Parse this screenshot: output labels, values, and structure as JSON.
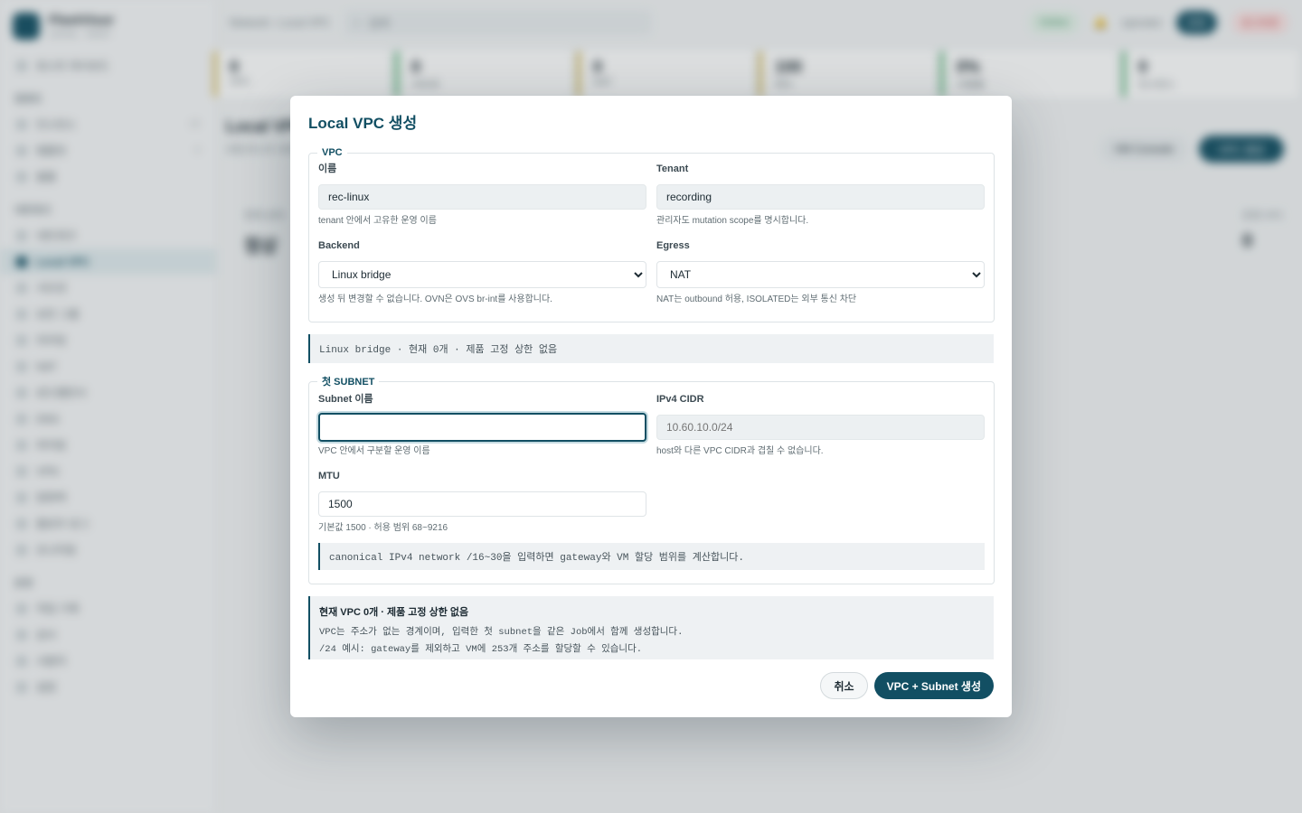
{
  "background": {
    "brand": {
      "name": "FleetVisor",
      "sub": "LOCAL · HOST"
    },
    "sidebar_top": "호스트 대시보드",
    "sections": [
      {
        "title": "컴퓨트",
        "items": [
          {
            "label": "인스턴스",
            "count": "12"
          },
          {
            "label": "템플릿",
            "count": "4"
          },
          {
            "label": "볼륨"
          }
        ]
      },
      {
        "title": "네트워크",
        "items": [
          {
            "label": "네트워크"
          },
          {
            "label": "Local VPC",
            "active": true
          },
          {
            "label": "서브넷"
          },
          {
            "label": "보안 그룹"
          },
          {
            "label": "라우팅"
          },
          {
            "label": "NAT"
          },
          {
            "label": "로드밸런서"
          },
          {
            "label": "DNS"
          },
          {
            "label": "피어링"
          },
          {
            "label": "VPN"
          },
          {
            "label": "방화벽"
          },
          {
            "label": "플로우 로그"
          },
          {
            "label": "모니터링"
          }
        ]
      },
      {
        "title": "운영",
        "items": [
          {
            "label": "작업 기록"
          },
          {
            "label": "감사"
          },
          {
            "label": "사용자"
          },
          {
            "label": "설정"
          }
        ]
      }
    ],
    "topbar": {
      "breadcrumb": "Network › Local VPC",
      "search_placeholder": "검색",
      "status": "Online",
      "user": "operator",
      "btn1": "운영",
      "btn2": "로그아웃"
    },
    "stats": [
      {
        "big": "0",
        "label": "VPC"
      },
      {
        "big": "0",
        "label": "서브넷"
      },
      {
        "big": "0",
        "label": "NAT"
      },
      {
        "big": "100",
        "label": "한도"
      },
      {
        "big": "0%",
        "label": "사용률"
      },
      {
        "big": "0",
        "label": "인스턴스"
      }
    ],
    "main": {
      "title": "Local VPC",
      "subtitle": "로컬 호스트 네트워크",
      "btn_ghost": "VM Console",
      "btn_dark": "VPC 생성",
      "card_label": "현재 상태",
      "card_value": "정상",
      "card2_label": "운영 VPC",
      "card2_value": "0"
    }
  },
  "modal": {
    "title": "Local VPC 생성",
    "vpc_legend": "VPC",
    "name": {
      "label": "이름",
      "value": "rec-linux",
      "hint": "tenant 안에서 고유한 운영 이름"
    },
    "tenant": {
      "label": "Tenant",
      "value": "recording",
      "hint": "관리자도 mutation scope를 명시합니다."
    },
    "backend": {
      "label": "Backend",
      "value": "Linux bridge",
      "hint": "생성 뒤 변경할 수 없습니다. OVN은 OVS br-int를 사용합니다."
    },
    "egress": {
      "label": "Egress",
      "value": "NAT",
      "hint": "NAT는 outbound 허용, ISOLATED는 외부 통신 차단"
    },
    "summary": "Linux bridge · 현재 0개 · 제품 고정 상한 없음",
    "subnet_legend": "첫 SUBNET",
    "subnet_name": {
      "label": "Subnet 이름",
      "value": "",
      "hint": "VPC 안에서 구분할 운영 이름"
    },
    "cidr": {
      "label": "IPv4 CIDR",
      "placeholder": "10.60.10.0/24",
      "hint": "host와 다른 VPC CIDR과 겹칠 수 없습니다."
    },
    "mtu": {
      "label": "MTU",
      "value": "1500",
      "hint": "기본값 1500 · 허용 범위 68~9216"
    },
    "cidr_note": "canonical IPv4 network /16~30을 입력하면 gateway와 VM 할당 범위를 계산합니다.",
    "note": {
      "title": "현재 VPC 0개 · 제품 고정 상한 없음",
      "line1": "VPC는 주소가 없는 경계이며, 입력한 첫 subnet을 같은 Job에서 함께 생성합니다.",
      "line2": "/24 예시: gateway를 제외하고 VM에 253개 주소를 할당할 수 있습니다."
    },
    "cancel": "취소",
    "submit": "VPC + Subnet 생성"
  }
}
